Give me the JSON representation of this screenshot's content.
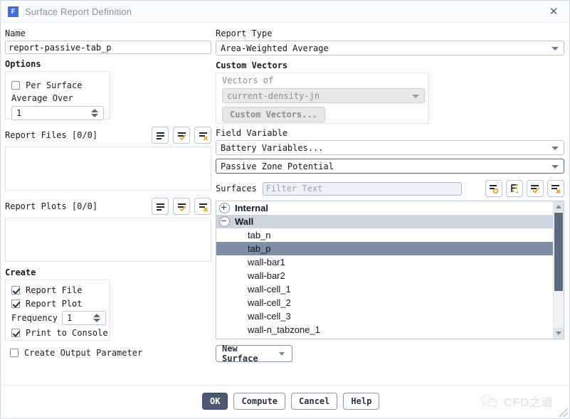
{
  "window": {
    "title": "Surface Report Definition",
    "app_icon": "fluent-f-icon",
    "close_label": "✕"
  },
  "left": {
    "name_label": "Name",
    "name_value": "report-passive-tab_p",
    "options_label": "Options",
    "per_surface_label": "Per Surface",
    "per_surface_checked": false,
    "average_over_label": "Average Over",
    "average_over_value": "1",
    "report_files_label": "Report Files [0/0]",
    "report_plots_label": "Report Plots [0/0]",
    "create_label": "Create",
    "report_file_label": "Report File",
    "report_file_checked": true,
    "report_plot_label": "Report Plot",
    "report_plot_checked": true,
    "frequency_label": "Frequency",
    "frequency_value": "1",
    "print_console_label": "Print to Console",
    "print_console_checked": true,
    "create_output_param_label": "Create Output Parameter",
    "create_output_param_checked": false,
    "list_icons": [
      "list-icon",
      "list-check-icon",
      "list-delete-icon"
    ]
  },
  "right": {
    "report_type_label": "Report Type",
    "report_type_value": "Area-Weighted Average",
    "custom_vectors_label": "Custom Vectors",
    "vectors_of_label": "Vectors of",
    "vectors_of_value": "current-density-jn",
    "custom_vectors_button": "Custom Vectors...",
    "field_variable_label": "Field Variable",
    "field_variable_value": "Battery Variables...",
    "field_variable_sub_value": "Passive Zone Potential",
    "surfaces_label": "Surfaces",
    "filter_placeholder": "Filter Text",
    "filter_value": "",
    "surface_icons": [
      "list-circle-icon",
      "tree-filter-icon",
      "list-check-icon",
      "list-delete-icon"
    ],
    "new_surface_button": "New Surface",
    "tree": [
      {
        "label": "Internal",
        "type": "group",
        "expanded": false,
        "highlight": "none"
      },
      {
        "label": "Wall",
        "type": "group",
        "expanded": true,
        "highlight": "light"
      },
      {
        "label": "tab_n",
        "type": "leaf",
        "highlight": "none"
      },
      {
        "label": "tab_p",
        "type": "leaf",
        "highlight": "dark"
      },
      {
        "label": "wall-bar1",
        "type": "leaf",
        "highlight": "none"
      },
      {
        "label": "wall-bar2",
        "type": "leaf",
        "highlight": "none"
      },
      {
        "label": "wall-cell_1",
        "type": "leaf",
        "highlight": "none"
      },
      {
        "label": "wall-cell_2",
        "type": "leaf",
        "highlight": "none"
      },
      {
        "label": "wall-cell_3",
        "type": "leaf",
        "highlight": "none"
      },
      {
        "label": "wall-n_tabzone_1",
        "type": "leaf",
        "highlight": "none"
      }
    ]
  },
  "footer": {
    "buttons": [
      {
        "label": "OK",
        "style": "primary"
      },
      {
        "label": "Compute",
        "style": "normal"
      },
      {
        "label": "Cancel",
        "style": "normal"
      },
      {
        "label": "Help",
        "style": "normal"
      }
    ],
    "watermark_text": "CFD之道",
    "watermark_icon": "wechat-icon"
  },
  "colors": {
    "accent_orange": "#e8a21c",
    "selection_dark": "#7d8ea5",
    "selection_light": "#ccd6e2",
    "primary_button": "#4b5a70",
    "app_icon_blue": "#3f6fd8"
  }
}
